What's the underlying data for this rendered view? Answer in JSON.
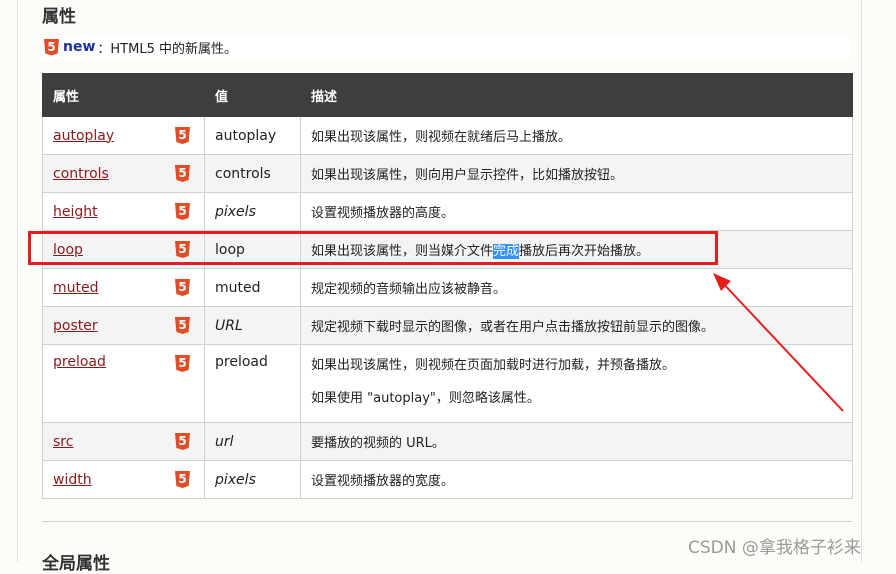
{
  "section_title": "属性",
  "note": {
    "new_label": "new",
    "rest": "：HTML5 中的新属性。"
  },
  "table": {
    "headers": [
      "属性",
      "值",
      "描述"
    ],
    "rows": [
      {
        "attr": "autoplay",
        "value": "autoplay",
        "desc": "如果出现该属性，则视频在就绪后马上播放。"
      },
      {
        "attr": "controls",
        "value": "controls",
        "desc": "如果出现该属性，则向用户显示控件，比如播放按钮。"
      },
      {
        "attr": "height",
        "value": "pixels",
        "desc": "设置视频播放器的高度。"
      },
      {
        "attr": "loop",
        "value": "loop",
        "desc_before": "如果出现该属性，则当媒介文件",
        "desc_selected": "完成",
        "desc_after": "播放后再次开始播放。"
      },
      {
        "attr": "muted",
        "value": "muted",
        "desc": "规定视频的音频输出应该被静音。"
      },
      {
        "attr": "poster",
        "value": "URL",
        "desc": "规定视频下载时显示的图像，或者在用户点击播放按钮前显示的图像。"
      },
      {
        "attr": "preload",
        "value": "preload",
        "desc": "如果出现该属性，则视频在页面加载时进行加载，并预备播放。",
        "desc2": "如果使用 \"autoplay\"，则忽略该属性。"
      },
      {
        "attr": "src",
        "value": "url",
        "desc": "要播放的视频的 URL。"
      },
      {
        "attr": "width",
        "value": "pixels",
        "desc": "设置视频播放器的宽度。"
      }
    ]
  },
  "next_section_title": "全局属性",
  "watermark": "CSDN @拿我格子衫来",
  "annotation": {
    "box_color": "#e41e1e",
    "arrow_color": "#e41e1e"
  },
  "icons": {
    "html5_badge": "html5-icon"
  }
}
